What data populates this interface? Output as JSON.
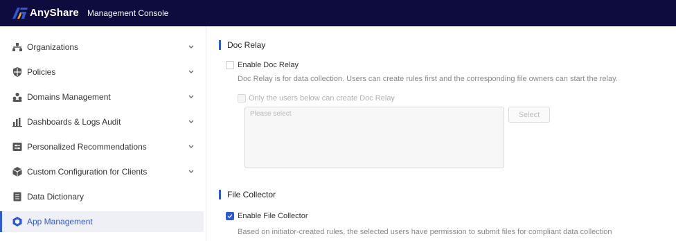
{
  "header": {
    "brand": "AnyShare",
    "console_title": "Management Console",
    "brand_colors": {
      "mark_blue": "#2c59d8",
      "mark_orange": "#f5a623",
      "bar": "#0e0c3f"
    }
  },
  "sidebar": {
    "items": [
      {
        "label": "Organizations",
        "icon": "org-chart-icon",
        "expandable": true
      },
      {
        "label": "Policies",
        "icon": "shield-icon",
        "expandable": true
      },
      {
        "label": "Domains Management",
        "icon": "users-icon",
        "expandable": true
      },
      {
        "label": "Dashboards & Logs Audit",
        "icon": "bar-chart-icon",
        "expandable": true
      },
      {
        "label": "Personalized Recommendations",
        "icon": "sliders-icon",
        "expandable": true
      },
      {
        "label": "Custom Configuration for Clients",
        "icon": "cube-icon",
        "expandable": true
      },
      {
        "label": "Data Dictionary",
        "icon": "book-icon",
        "expandable": false
      },
      {
        "label": "App Management",
        "icon": "app-hexagon-icon",
        "expandable": false,
        "active": true
      }
    ],
    "active_color": "#2c59d8"
  },
  "main": {
    "doc_relay": {
      "title": "Doc Relay",
      "enable_label": "Enable Doc Relay",
      "enabled": false,
      "description": "Doc Relay is for data collection. Users can create rules first and the corresponding file owners can start the relay.",
      "restrict_label": "Only the users below can create Doc Relay",
      "restrict_checked": false,
      "select_placeholder": "Please select",
      "select_button": "Select"
    },
    "file_collector": {
      "title": "File Collector",
      "enable_label": "Enable File Collector",
      "enabled": true,
      "description": "Based on initiator-created rules, the selected users have permission to submit files for compliant data collection"
    }
  }
}
